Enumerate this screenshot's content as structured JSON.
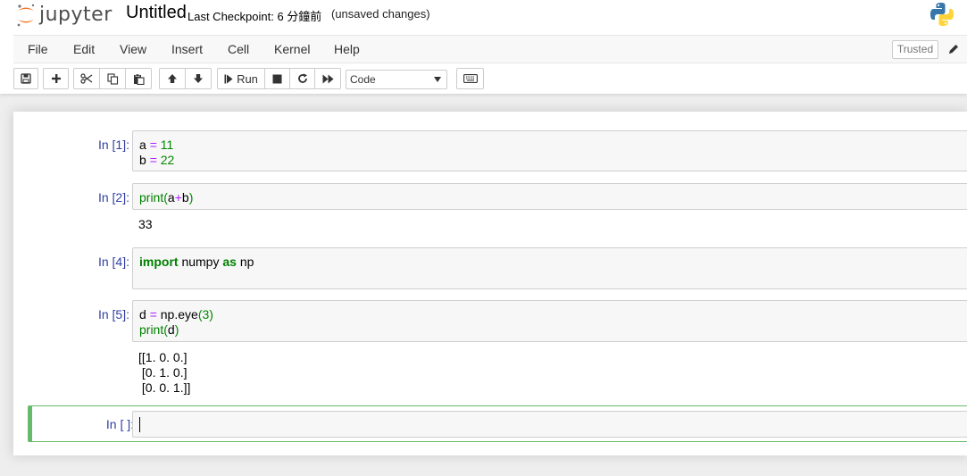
{
  "header": {
    "logo_text": "jupyter",
    "notebook_title": "Untitled",
    "checkpoint": "Last Checkpoint: 6 分鐘前",
    "autosave_status": "(unsaved changes)"
  },
  "menubar": {
    "items": [
      "File",
      "Edit",
      "View",
      "Insert",
      "Cell",
      "Kernel",
      "Help"
    ],
    "trusted_label": "Trusted",
    "kernel_indicator_fragment": "P"
  },
  "toolbar": {
    "run_label": "Run",
    "cell_type": "Code",
    "icons": [
      "save-icon",
      "plus-icon",
      "cut-icon",
      "copy-icon",
      "paste-icon",
      "arrow-up-icon",
      "arrow-down-icon",
      "step-forward-icon",
      "stop-icon",
      "restart-icon",
      "fast-forward-icon",
      "keyboard-icon"
    ]
  },
  "cells": [
    {
      "prompt": "In [1]:",
      "code": [
        "a = 11",
        "b = 22"
      ],
      "output": []
    },
    {
      "prompt": "In [2]:",
      "code": [
        "print(a+b)"
      ],
      "output": [
        "33"
      ]
    },
    {
      "prompt": "In [4]:",
      "code": [
        "import numpy as np"
      ],
      "output": []
    },
    {
      "prompt": "In [5]:",
      "code": [
        "d = np.eye(3)",
        "print(d)"
      ],
      "output": [
        "[[1. 0. 0.]",
        " [0. 1. 0.]",
        " [0. 0. 1.]]"
      ]
    },
    {
      "prompt": "In [ ]:",
      "code": [
        ""
      ],
      "output": [],
      "selected": true
    }
  ],
  "colors": {
    "prompt_in": "#303f9f",
    "selected_border": "#66bb6a",
    "operator": "#aa22ff",
    "number_builtin_keyword": "#008000",
    "jupyter_orange": "#f37726"
  }
}
